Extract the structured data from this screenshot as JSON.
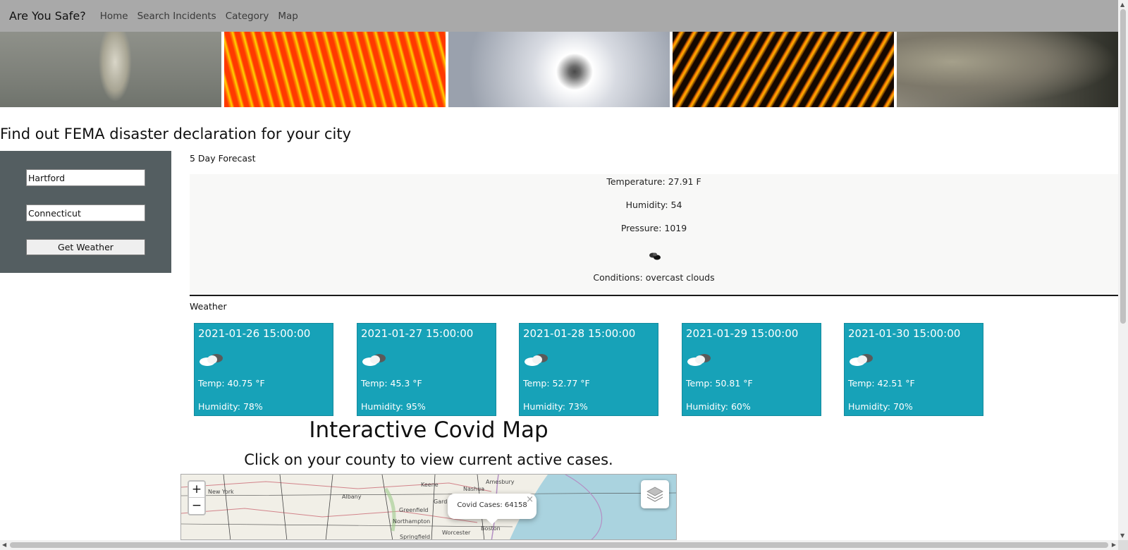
{
  "nav": {
    "brand": "Are You Safe?",
    "links": [
      "Home",
      "Search Incidents",
      "Category",
      "Map"
    ]
  },
  "heading": "Find out FEMA disaster declaration for your city",
  "form": {
    "city": "Hartford",
    "state": "Connecticut",
    "button_label": "Get Weather"
  },
  "forecast": {
    "title": "5 Day Forecast",
    "current": {
      "temperature": "Temperature: 27.91 F",
      "humidity": "Humidity: 54",
      "pressure": "Pressure: 1019",
      "conditions": "Conditions: overcast clouds",
      "icon": "overcast-clouds-icon"
    }
  },
  "weather": {
    "title": "Weather",
    "cards": [
      {
        "date": "2021-01-26 15:00:00",
        "temp": "Temp: 40.75 °F",
        "humidity": "Humidity: 78%",
        "icon": "cloud-icon"
      },
      {
        "date": "2021-01-27 15:00:00",
        "temp": "Temp: 45.3 °F",
        "humidity": "Humidity: 95%",
        "icon": "cloud-icon"
      },
      {
        "date": "2021-01-28 15:00:00",
        "temp": "Temp: 52.77 °F",
        "humidity": "Humidity: 73%",
        "icon": "cloud-icon"
      },
      {
        "date": "2021-01-29 15:00:00",
        "temp": "Temp: 50.81 °F",
        "humidity": "Humidity: 60%",
        "icon": "cloud-icon"
      },
      {
        "date": "2021-01-30 15:00:00",
        "temp": "Temp: 42.51 °F",
        "humidity": "Humidity: 70%",
        "icon": "cloud-icon"
      }
    ]
  },
  "covid": {
    "title": "Interactive Covid Map",
    "subtitle": "Click on your county to view current active cases.",
    "popup": "Covid Cases: 64158",
    "zoom_in": "+",
    "zoom_out": "−",
    "map_labels": [
      "New York",
      "Albany",
      "Keene",
      "Nashua",
      "Amesbury",
      "Greenfield",
      "Gardner",
      "Northampton",
      "Worcester",
      "Springfield",
      "Boston"
    ]
  },
  "colors": {
    "navbar": "#a9a9a9",
    "form_panel": "#545e61",
    "card": "#17a2b8"
  }
}
